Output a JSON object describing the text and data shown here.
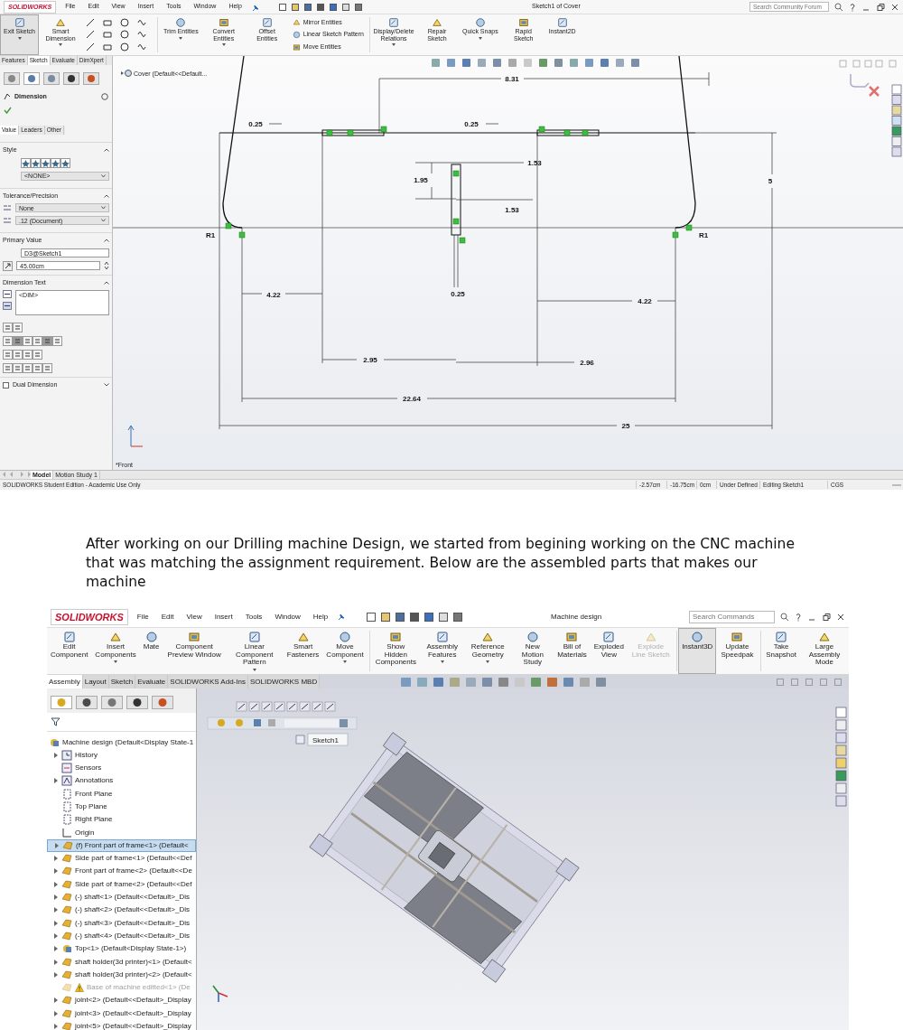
{
  "sketch_window": {
    "logo": "SOLIDWORKS",
    "menu": [
      "File",
      "Edit",
      "View",
      "Insert",
      "Tools",
      "Window",
      "Help"
    ],
    "title": "Sketch1 of Cover",
    "search": {
      "placeholder": "Search Community Forum"
    },
    "ribbon": [
      {
        "kind": "large",
        "label": "Exit Sketch",
        "selected": true,
        "dropdown": true
      },
      {
        "kind": "large",
        "label": "Smart Dimension",
        "selected": false,
        "dropdown": true
      },
      {
        "kind": "tools"
      },
      {
        "kind": "large",
        "label": "Trim Entities",
        "selected": false,
        "dropdown": true
      },
      {
        "kind": "large",
        "label": "Convert Entities",
        "selected": false,
        "dropdown": true
      },
      {
        "kind": "large",
        "label": "Offset Entities",
        "selected": false,
        "dropdown": false
      },
      {
        "kind": "stack",
        "items": [
          "Mirror Entities",
          "Linear Sketch Pattern",
          "Move Entities"
        ]
      },
      {
        "kind": "large",
        "label": "Display/Delete Relations",
        "selected": false,
        "dropdown": true
      },
      {
        "kind": "large",
        "label": "Repair Sketch",
        "selected": false,
        "dropdown": false
      },
      {
        "kind": "large",
        "label": "Quick Snaps",
        "selected": false,
        "dropdown": true
      },
      {
        "kind": "large",
        "label": "Rapid Sketch",
        "selected": false,
        "dropdown": false
      },
      {
        "kind": "large",
        "label": "Instant2D",
        "selected": false,
        "dropdown": false
      }
    ],
    "tabs": [
      {
        "label": "Features",
        "selected": false
      },
      {
        "label": "Sketch",
        "selected": true
      },
      {
        "label": "Evaluate",
        "selected": false
      },
      {
        "label": "DimXpert",
        "selected": false
      }
    ],
    "feature_tree": {
      "label": "Cover  (Default<<Default...",
      "expanded": false
    },
    "property_manager": {
      "title": "Dimension",
      "tabs": [
        {
          "label": "Value",
          "selected": true
        },
        {
          "label": "Leaders",
          "selected": false
        },
        {
          "label": "Other",
          "selected": false
        }
      ],
      "sections": [
        {
          "kind": "style",
          "title": "Style",
          "dropdown": "<NONE>"
        },
        {
          "kind": "tolerance",
          "title": "Tolerance/Precision",
          "dropdowns": [
            "None",
            ".12 (Document)"
          ]
        },
        {
          "kind": "primary",
          "title": "Primary Value",
          "name": "D3@Sketch1",
          "value": "45.00cm"
        },
        {
          "kind": "text",
          "title": "Dimension Text",
          "text": "<DIM>"
        }
      ],
      "dual_dimension": {
        "label": "Dual Dimension",
        "checked": false
      }
    },
    "dimension_labels": [
      "0.25",
      "0.25",
      "8.31",
      "1.53",
      "1.95",
      "1.53",
      "5",
      "R1",
      "R1",
      "4.22",
      "4.22",
      "0.25",
      "2.95",
      "2.96",
      "22.64",
      "25"
    ],
    "view_label": "*Front",
    "bottom_tabs": [
      {
        "label": "Model",
        "selected": true
      },
      {
        "label": "Motion Study 1",
        "selected": false
      }
    ],
    "status_bar": [
      "SOLIDWORKS Student Edition - Academic Use Only",
      "-2.57cm",
      "-16.75cm",
      "0cm",
      "Under Defined",
      "Editing Sketch1",
      "CGS"
    ]
  },
  "paragraph": "After working on our Drilling machine Design, we started from begining working on the CNC machine that was matching the assignment requirement. Below are the assembled parts that makes our machine",
  "assembly_window": {
    "logo": "SOLIDWORKS",
    "menu": [
      "File",
      "Edit",
      "View",
      "Insert",
      "Tools",
      "Window",
      "Help"
    ],
    "title": "Machine design",
    "search": {
      "placeholder": "Search Commands"
    },
    "ribbon": [
      {
        "label": "Edit Component",
        "selected": false,
        "disabled": false,
        "dropdown": false
      },
      {
        "label": "Insert Components",
        "selected": false,
        "disabled": false,
        "dropdown": true
      },
      {
        "label": "Mate",
        "selected": false,
        "disabled": false,
        "dropdown": false
      },
      {
        "label": "Component Preview Window",
        "selected": false,
        "disabled": false,
        "dropdown": false
      },
      {
        "label": "Linear Component Pattern",
        "selected": false,
        "disabled": false,
        "dropdown": true
      },
      {
        "label": "Smart Fasteners",
        "selected": false,
        "disabled": false,
        "dropdown": false
      },
      {
        "label": "Move Component",
        "selected": false,
        "disabled": false,
        "dropdown": true
      },
      {
        "label": "Show Hidden Components",
        "selected": false,
        "disabled": false,
        "dropdown": false
      },
      {
        "label": "Assembly Features",
        "selected": false,
        "disabled": false,
        "dropdown": true
      },
      {
        "label": "Reference Geometry",
        "selected": false,
        "disabled": false,
        "dropdown": true
      },
      {
        "label": "New Motion Study",
        "selected": false,
        "disabled": false,
        "dropdown": false
      },
      {
        "label": "Bill of Materials",
        "selected": false,
        "disabled": false,
        "dropdown": false
      },
      {
        "label": "Exploded View",
        "selected": false,
        "disabled": false,
        "dropdown": false
      },
      {
        "label": "Explode Line Sketch",
        "selected": false,
        "disabled": true,
        "dropdown": false
      },
      {
        "label": "Instant3D",
        "selected": true,
        "disabled": false,
        "dropdown": false
      },
      {
        "label": "Update Speedpak",
        "selected": false,
        "disabled": false,
        "dropdown": false
      },
      {
        "label": "Take Snapshot",
        "selected": false,
        "disabled": false,
        "dropdown": false
      },
      {
        "label": "Large Assembly Mode",
        "selected": false,
        "disabled": false,
        "dropdown": false
      }
    ],
    "tabs": [
      {
        "label": "Assembly",
        "selected": true
      },
      {
        "label": "Layout",
        "selected": false
      },
      {
        "label": "Sketch",
        "selected": false
      },
      {
        "label": "Evaluate",
        "selected": false
      },
      {
        "label": "SOLIDWORKS Add-Ins",
        "selected": false
      },
      {
        "label": "SOLIDWORKS MBD",
        "selected": false
      }
    ],
    "tree": {
      "label": "Machine design  (Default<Display State-1",
      "kind": "assembly",
      "children": [
        {
          "label": "History",
          "kind": "history",
          "expanded": false,
          "selected": false,
          "suppressed": false,
          "warning": false
        },
        {
          "label": "Sensors",
          "kind": "sensor",
          "selected": false,
          "suppressed": false,
          "warning": false
        },
        {
          "label": "Annotations",
          "kind": "annotation",
          "expanded": false,
          "selected": false,
          "suppressed": false,
          "warning": false
        },
        {
          "label": "Front Plane",
          "kind": "plane",
          "selected": false,
          "suppressed": false,
          "warning": false
        },
        {
          "label": "Top Plane",
          "kind": "plane",
          "selected": false,
          "suppressed": false,
          "warning": false
        },
        {
          "label": "Right Plane",
          "kind": "plane",
          "selected": false,
          "suppressed": false,
          "warning": false
        },
        {
          "label": "Origin",
          "kind": "origin",
          "selected": false,
          "suppressed": false,
          "warning": false
        },
        {
          "label": "(f) Front part of frame<1> (Default<",
          "kind": "part",
          "expanded": false,
          "selected": true,
          "suppressed": false,
          "warning": false
        },
        {
          "label": "Side part of frame<1> (Default<<Def",
          "kind": "part",
          "expanded": false,
          "selected": false,
          "suppressed": false,
          "warning": false
        },
        {
          "label": "Front part of frame<2> (Default<<De",
          "kind": "part",
          "expanded": false,
          "selected": false,
          "suppressed": false,
          "warning": false
        },
        {
          "label": "Side part of frame<2> (Default<<Def",
          "kind": "part",
          "expanded": false,
          "selected": false,
          "suppressed": false,
          "warning": false
        },
        {
          "label": "(-) shaft<1> (Default<<Default>_Dis",
          "kind": "part",
          "expanded": false,
          "selected": false,
          "suppressed": false,
          "warning": false
        },
        {
          "label": "(-) shaft<2> (Default<<Default>_Dis",
          "kind": "part",
          "expanded": false,
          "selected": false,
          "suppressed": false,
          "warning": false
        },
        {
          "label": "(-) shaft<3> (Default<<Default>_Dis",
          "kind": "part",
          "expanded": false,
          "selected": false,
          "suppressed": false,
          "warning": false
        },
        {
          "label": "(-) shaft<4> (Default<<Default>_Dis",
          "kind": "part",
          "expanded": false,
          "selected": false,
          "suppressed": false,
          "warning": false
        },
        {
          "label": "Top<1> (Default<Display State-1>)",
          "kind": "assembly",
          "expanded": false,
          "selected": false,
          "suppressed": false,
          "warning": false
        },
        {
          "label": "shaft holder(3d printer)<1> (Default<",
          "kind": "part",
          "expanded": false,
          "selected": false,
          "suppressed": false,
          "warning": false
        },
        {
          "label": "shaft holder(3d printer)<2> (Default<",
          "kind": "part",
          "expanded": false,
          "selected": false,
          "suppressed": false,
          "warning": false
        },
        {
          "label": "Base of machine editted<1> (De",
          "kind": "part",
          "selected": false,
          "suppressed": true,
          "warning": true
        },
        {
          "label": "joint<2> (Default<<Default>_Display",
          "kind": "part",
          "expanded": false,
          "selected": false,
          "suppressed": false,
          "warning": false
        },
        {
          "label": "joint<3> (Default<<Default>_Display",
          "kind": "part",
          "expanded": false,
          "selected": false,
          "suppressed": false,
          "warning": false
        },
        {
          "label": "joint<5> (Default<<Default>_Display",
          "kind": "part",
          "expanded": false,
          "selected": false,
          "suppressed": false,
          "warning": false
        }
      ]
    },
    "sketch_label": "Sketch1"
  }
}
